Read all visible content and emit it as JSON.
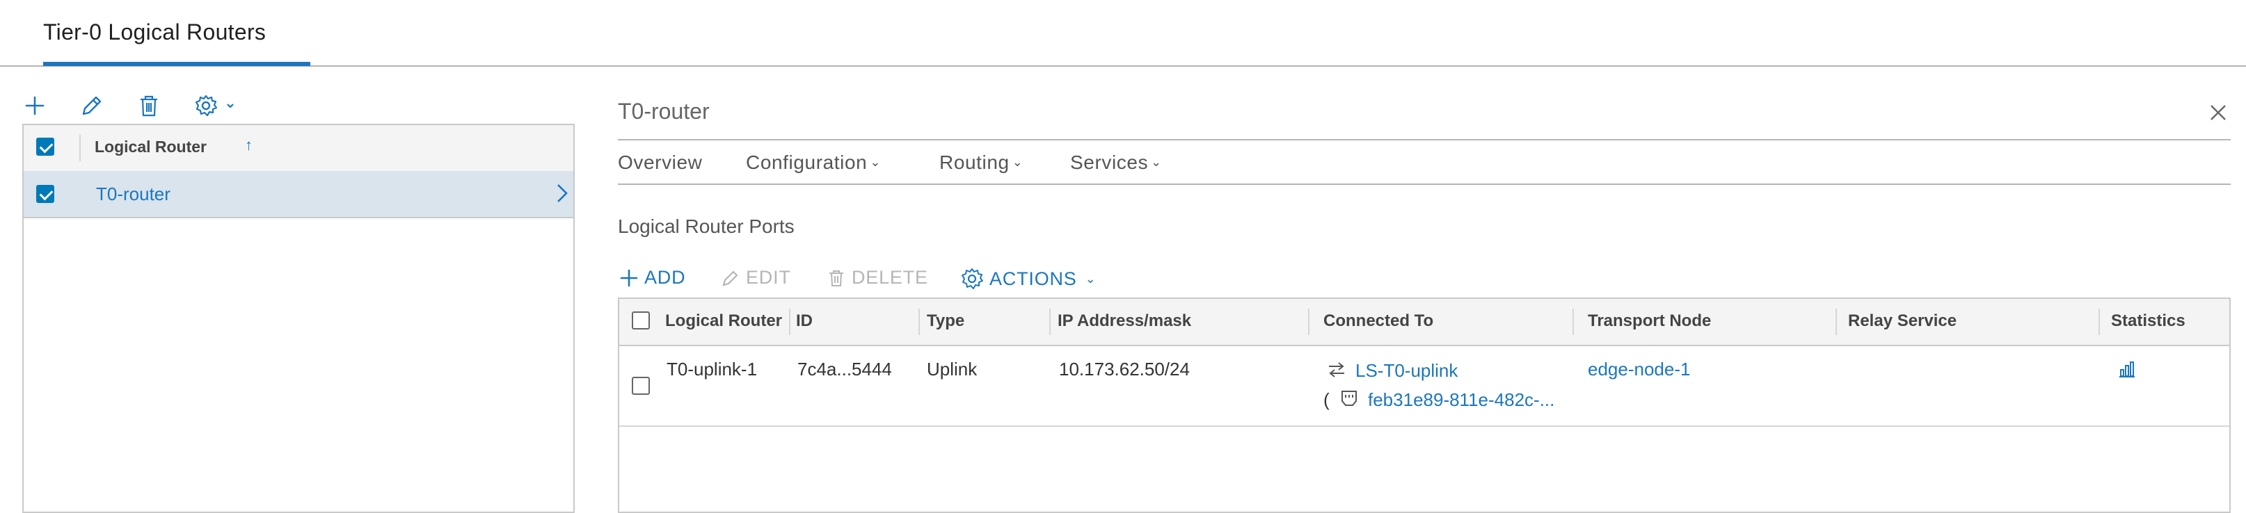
{
  "header": {
    "title": "Tier-0 Logical Routers"
  },
  "left_panel": {
    "toolbar": [
      {
        "name": "add-icon"
      },
      {
        "name": "edit-icon"
      },
      {
        "name": "delete-icon"
      },
      {
        "name": "gear-icon"
      }
    ],
    "grid": {
      "column_header": "Logical Router",
      "sort_indicator": "↑",
      "rows": [
        {
          "label": "T0-router",
          "selected": true
        }
      ]
    }
  },
  "detail": {
    "title": "T0-router",
    "tabs": [
      {
        "label": "Overview",
        "has_menu": false
      },
      {
        "label": "Configuration",
        "has_menu": true
      },
      {
        "label": "Routing",
        "has_menu": true
      },
      {
        "label": "Services",
        "has_menu": true
      }
    ],
    "section_title": "Logical Router Ports",
    "actions": {
      "add": "ADD",
      "edit": "EDIT",
      "delete": "DELETE",
      "actions": "ACTIONS"
    },
    "ports_table": {
      "columns": [
        "Logical Router",
        "ID",
        "Type",
        "IP Address/mask",
        "Connected To",
        "Transport Node",
        "Relay Service",
        "Statistics"
      ],
      "rows": [
        {
          "name": "T0-uplink-1",
          "id": "7c4a...5444",
          "type": "Uplink",
          "ip": "10.173.62.50/24",
          "connected_switch": "LS-T0-uplink",
          "connected_prefix": "(",
          "connected_port": "feb31e89-811e-482c-...",
          "transport_node": "edge-node-1",
          "relay_service": "",
          "statistics_icon": "bar-chart-icon"
        }
      ]
    }
  },
  "colors": {
    "accent": "#1b76c0",
    "selected_row": "#d9e4ec",
    "header_bg": "#f4f4f4",
    "disabled": "#b5b5b5"
  }
}
